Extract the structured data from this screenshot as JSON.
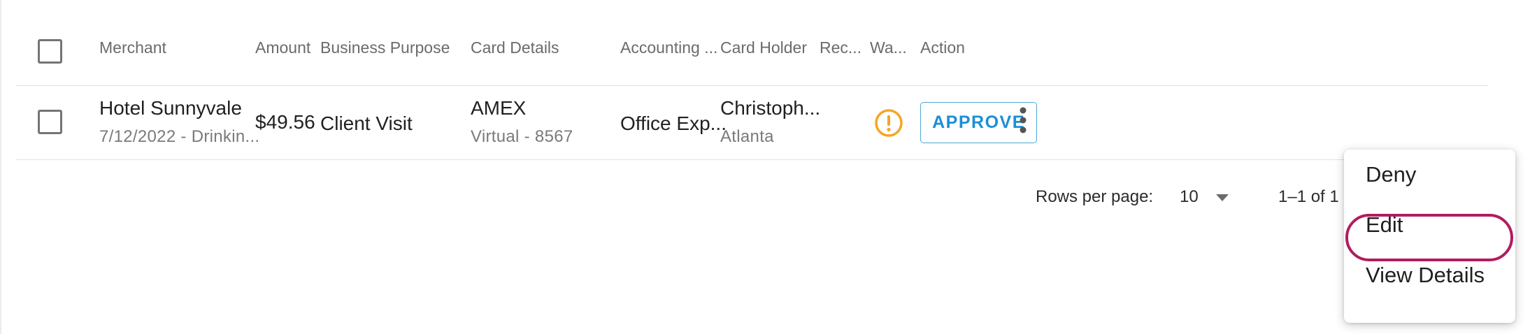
{
  "table": {
    "columns": {
      "merchant": "Merchant",
      "amount": "Amount",
      "business_purpose": "Business Purpose",
      "card_details": "Card Details",
      "accounting": "Accounting ...",
      "card_holder": "Card Holder",
      "receipt": "Rec...",
      "warning": "Wa...",
      "action": "Action"
    },
    "rows": [
      {
        "merchant": "Hotel Sunnyvale",
        "merchant_sub": "7/12/2022 - Drinkin...",
        "amount": "$49.56",
        "business_purpose": "Client Visit",
        "card_network": "AMEX",
        "card_sub": "Virtual - 8567",
        "accounting": "Office Exp...",
        "card_holder": "Christoph...",
        "card_holder_sub": "Atlanta",
        "warning_icon": "exclamation-circle-icon",
        "approve_label": "APPROVE"
      }
    ]
  },
  "pagination": {
    "rows_per_page_label": "Rows per page:",
    "rows_per_page_value": "10",
    "range_label": "1–1 of 1"
  },
  "action_menu": {
    "items": [
      "Deny",
      "Edit",
      "View Details"
    ],
    "highlighted": "Edit"
  },
  "colors": {
    "accent": "#1a8fd6",
    "warning": "#f5a623",
    "highlight": "#b01d5e"
  }
}
